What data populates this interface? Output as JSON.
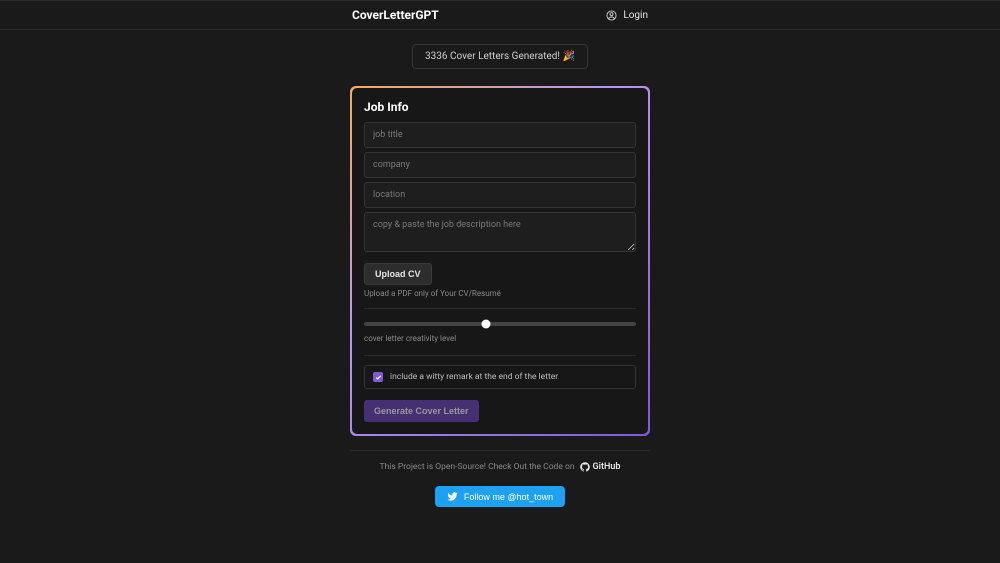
{
  "header": {
    "brand": "CoverLetterGPT",
    "login_label": "Login"
  },
  "stats_badge": "3336 Cover Letters Generated! 🎉",
  "form": {
    "title": "Job Info",
    "job_title_placeholder": "job title",
    "company_placeholder": "company",
    "location_placeholder": "location",
    "description_placeholder": "copy & paste the job description here",
    "upload_label": "Upload CV",
    "upload_hint": "Upload a PDF only of Your CV/Resumé",
    "slider_label": "cover letter creativity level",
    "checkbox_label": "include a witty remark at the end of the letter",
    "generate_label": "Generate Cover Letter"
  },
  "footer": {
    "text": "This Project is Open-Source! Check Out the Code on",
    "github_label": "GitHub",
    "twitter_label": "Follow me @hot_town"
  }
}
